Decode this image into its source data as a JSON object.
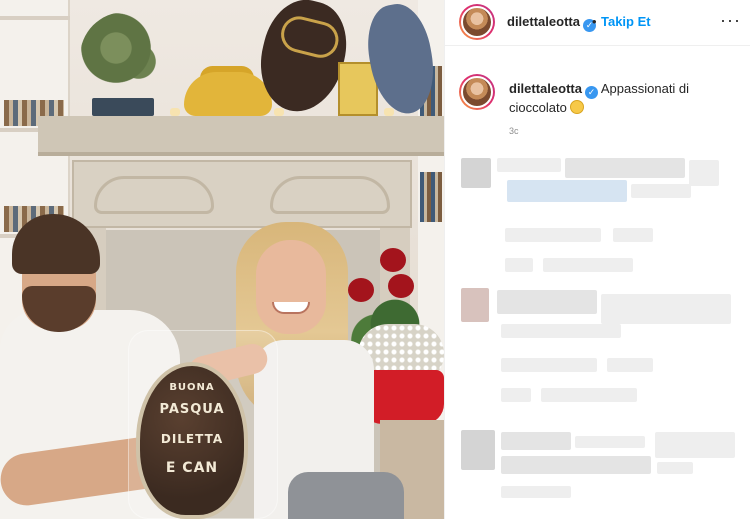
{
  "post": {
    "username": "dilettaleotta",
    "follow_label": "Takip Et",
    "separator": "•",
    "more_label": "···",
    "verified_mark": "✓",
    "caption_text": "Appassionati di cioccolato",
    "caption_emoji": "face-with-hand-over-mouth",
    "time_label": "3c",
    "photo": {
      "egg_lines": [
        "BUONA",
        "PASQUA",
        "DILETTA",
        "E CAN"
      ]
    }
  },
  "colors": {
    "accent_blue": "#0095f6",
    "verified_blue": "#3897f0",
    "text": "#262626",
    "muted": "#8e8e8e"
  },
  "icons": {
    "verified": "verified-badge-icon",
    "more": "more-options-icon"
  }
}
